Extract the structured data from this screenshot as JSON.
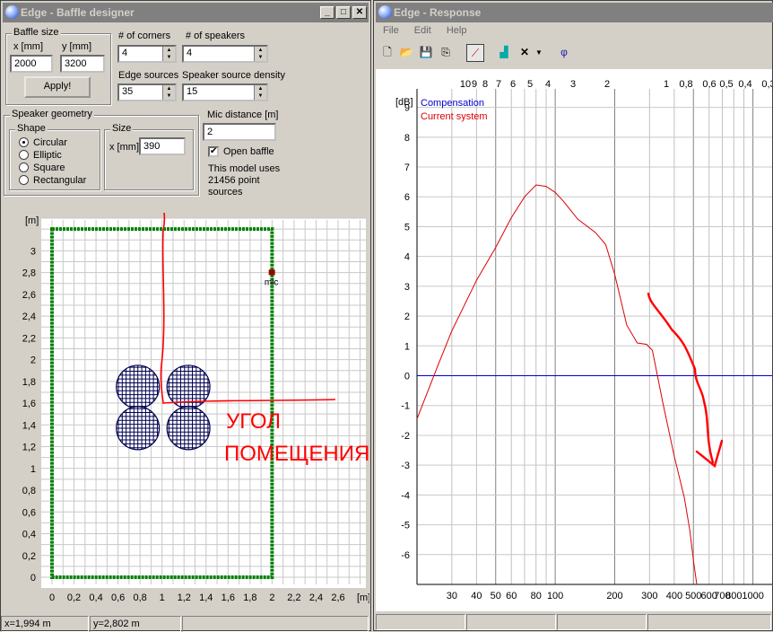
{
  "left": {
    "title": "Edge - Baffle designer",
    "baffle": {
      "group": "Baffle size",
      "x_label": "x [mm]",
      "y_label": "y [mm]",
      "x": "2000",
      "y": "3200",
      "apply": "Apply!"
    },
    "corners": {
      "label": "# of corners",
      "value": "4"
    },
    "speakers": {
      "label": "# of speakers",
      "value": "4"
    },
    "edge_sources": {
      "label": "Edge sources",
      "value": "35"
    },
    "density": {
      "label": "Speaker source density",
      "value": "15"
    },
    "geometry": {
      "group": "Speaker geometry",
      "shape_group": "Shape",
      "shapes": [
        "Circular",
        "Elliptic",
        "Square",
        "Rectangular"
      ],
      "size_group": "Size",
      "size_label": "x [mm]",
      "size_value": "390"
    },
    "mic": {
      "label": "Mic distance [m]",
      "value": "2"
    },
    "open_baffle": "Open baffle",
    "model_info": [
      "This model uses",
      "21456 point",
      "sources"
    ],
    "plot": {
      "y_unit": "[m]",
      "x_unit": "[m]",
      "y_ticks": [
        "0",
        "0,2",
        "0,4",
        "0,6",
        "0,8",
        "1",
        "1,2",
        "1,4",
        "1,6",
        "1,8",
        "2",
        "2,2",
        "2,4",
        "2,6",
        "2,8",
        "3"
      ],
      "x_ticks": [
        "0",
        "0,2",
        "0,4",
        "0,6",
        "0,8",
        "1",
        "1,2",
        "1,4",
        "1,6",
        "1,8",
        "2",
        "2,2",
        "2,4",
        "2,6"
      ],
      "mic_label": "mic",
      "handwritten": [
        "УГОЛ",
        "ПОМЕЩЕНИЯ"
      ]
    },
    "status": {
      "x": "x=1,994 m",
      "y": "y=2,802 m"
    }
  },
  "right": {
    "title": "Edge - Response",
    "menu": [
      "File",
      "Edit",
      "Help"
    ],
    "toolbar_icons": [
      "new-icon",
      "open-icon",
      "save-icon",
      "copy-icon",
      "pen-icon",
      "speaker-icon",
      "close-icon",
      "dropdown-icon",
      "phase-icon"
    ],
    "phase_glyph": "φ",
    "chart_data": {
      "type": "line",
      "y_unit": "[dB]",
      "ylim": [
        -7,
        9.5
      ],
      "xlim": [
        20,
        1250
      ],
      "x_scale": "log",
      "y_ticks": [
        "9",
        "8",
        "7",
        "6",
        "5",
        "4",
        "3",
        "2",
        "1",
        "0",
        "-1",
        "-2",
        "-3",
        "-4",
        "-5",
        "-6"
      ],
      "x_ticks": [
        "30",
        "40",
        "50",
        "60",
        "80",
        "100",
        "200",
        "300",
        "400",
        "500",
        "600",
        "700",
        "800",
        "1000"
      ],
      "top_axis_ticks": [
        "10",
        "9",
        "8",
        "7",
        "6",
        "5",
        "4",
        "3",
        "2",
        "1",
        "0,8",
        "0,6",
        "0,5",
        "0,4",
        "0,3"
      ],
      "series": [
        {
          "name": "Compensation",
          "color": "#0000cc",
          "points": [
            [
              20,
              0
            ],
            [
              1250,
              0
            ]
          ]
        },
        {
          "name": "Current system",
          "color": "#dd0000",
          "points": [
            [
              20,
              -1.45
            ],
            [
              25,
              0.2
            ],
            [
              30,
              1.5
            ],
            [
              40,
              3.2
            ],
            [
              50,
              4.3
            ],
            [
              60,
              5.3
            ],
            [
              70,
              6.0
            ],
            [
              80,
              6.4
            ],
            [
              90,
              6.35
            ],
            [
              100,
              6.15
            ],
            [
              110,
              5.85
            ],
            [
              130,
              5.25
            ],
            [
              160,
              4.8
            ],
            [
              180,
              4.4
            ],
            [
              200,
              3.4
            ],
            [
              230,
              1.7
            ],
            [
              260,
              1.1
            ],
            [
              290,
              1.05
            ],
            [
              310,
              0.85
            ],
            [
              350,
              -0.9
            ],
            [
              400,
              -2.7
            ],
            [
              450,
              -4.1
            ],
            [
              480,
              -5.2
            ],
            [
              500,
              -6.2
            ],
            [
              520,
              -7
            ]
          ]
        }
      ]
    }
  }
}
